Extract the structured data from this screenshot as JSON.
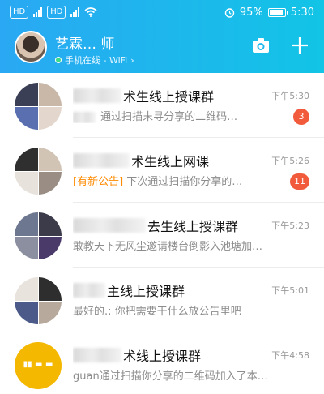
{
  "status_bar": {
    "carrier_badge_1": "HD",
    "carrier_badge_2": "HD",
    "battery": "95%",
    "time": "5:30",
    "battery_level": 0.95,
    "icons": [
      "signal-icon",
      "wifi-icon",
      "alarm-icon",
      "battery-icon"
    ]
  },
  "header": {
    "user_name": "艺霖… 师",
    "online_status": "手机在线 - WiFi",
    "online_chevron": "›",
    "accent_gradient": [
      "#2aa8f3",
      "#12c4e6"
    ],
    "icons": [
      "camera-icon",
      "plus-icon"
    ]
  },
  "conversations": [
    {
      "title": "术生线上授课群",
      "time": "下午5:30",
      "preview": "通过扫描末寻分享的二维码…",
      "tag": "",
      "unread": "3"
    },
    {
      "title": "术生线上网课",
      "time": "下午5:26",
      "preview": "下次通过扫描你分享的…",
      "tag": "[有新公告]",
      "unread": "11"
    },
    {
      "title": "去生线上授课群",
      "time": "下午5:23",
      "preview": "敢教天下无风尘邀请楼台倒影入池塘加…",
      "tag": "",
      "unread": ""
    },
    {
      "title": "主线上授课群",
      "time": "下午5:01",
      "preview": "最好的.: 你把需要干什么放公告里吧",
      "tag": "",
      "unread": ""
    },
    {
      "title": "术线上授课群",
      "time": "下午4:58",
      "preview": "guan通过扫描你分享的二维码加入了本…",
      "tag": "",
      "unread": ""
    }
  ],
  "colors": {
    "badge": "#f25a3c",
    "tag": "#ff8a00",
    "online": "#3ddc84"
  }
}
